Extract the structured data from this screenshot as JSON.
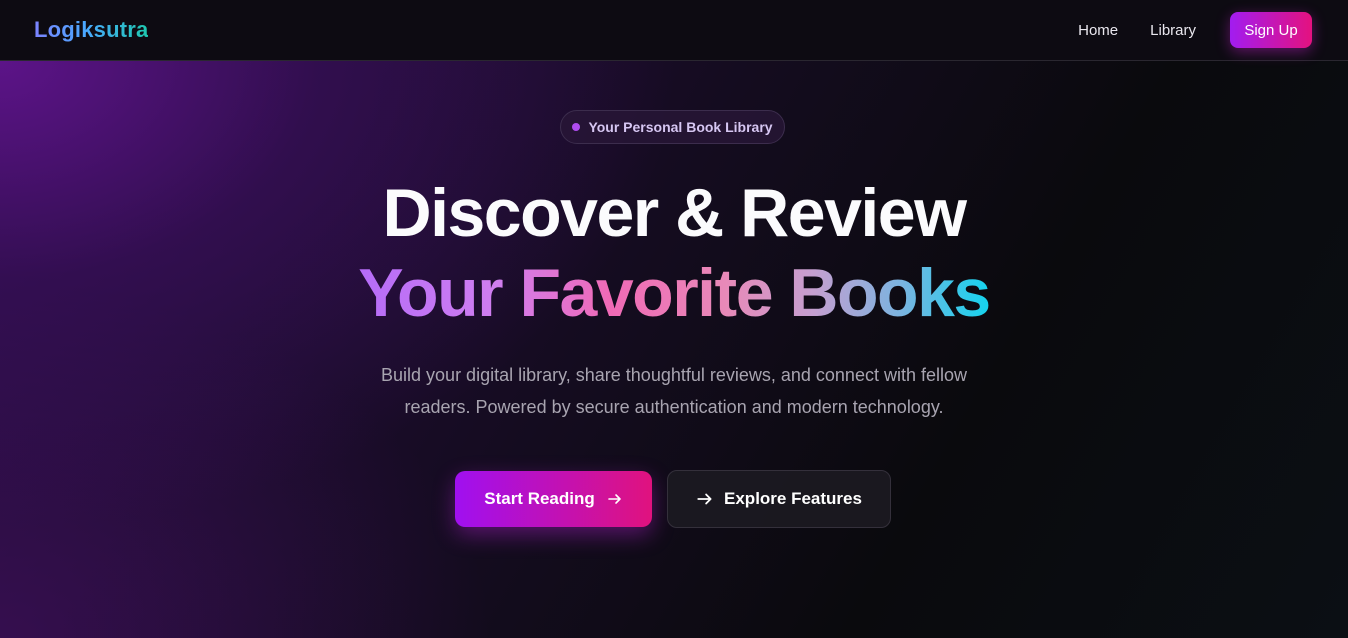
{
  "nav": {
    "logo": "Logiksutra",
    "links": [
      {
        "label": "Home"
      },
      {
        "label": "Library"
      }
    ],
    "signup_label": "Sign Up"
  },
  "hero": {
    "badge": "Your Personal Book Library",
    "headline_line1": "Discover & Review",
    "headline_line2": "Your Favorite Books",
    "subtitle_line1": "Build your digital library, share thoughtful reviews, and connect with fellow",
    "subtitle_line2": "readers. Powered by secure authentication and modern technology.",
    "primary_cta": "Start Reading",
    "secondary_cta": "Explore Features"
  },
  "colors": {
    "accent_purple": "#a010f0",
    "accent_pink": "#e0127e",
    "logo_gradient": [
      "#7c83ff",
      "#1ec8b0"
    ],
    "background": "#0b0a0f"
  },
  "icons": {
    "primary_cta_icon": "arrow-right-icon",
    "secondary_cta_icon": "arrow-right-icon",
    "badge_icon": "dot-icon"
  }
}
